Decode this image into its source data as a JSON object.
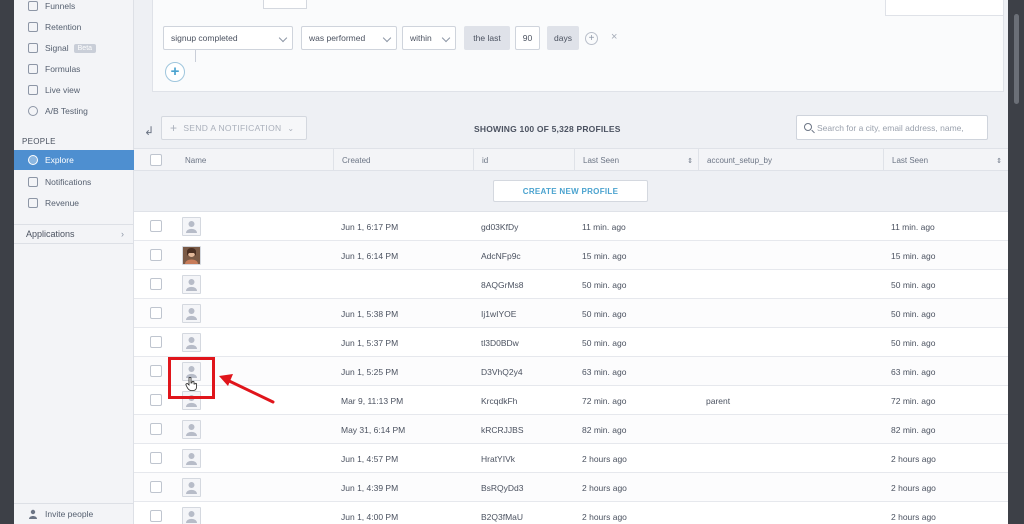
{
  "sidebar": {
    "items_top": [
      {
        "label": "Funnels",
        "icon": "funnel-icon"
      },
      {
        "label": "Retention",
        "icon": "retention-icon"
      },
      {
        "label": "Signal",
        "icon": "signal-icon",
        "badge": "Beta"
      },
      {
        "label": "Formulas",
        "icon": "formula-icon"
      },
      {
        "label": "Live view",
        "icon": "live-view-icon"
      },
      {
        "label": "A/B Testing",
        "icon": "ab-testing-icon"
      }
    ],
    "people_heading": "PEOPLE",
    "people_items": [
      {
        "label": "Explore",
        "icon": "explore-icon",
        "active": true
      },
      {
        "label": "Notifications",
        "icon": "notifications-icon"
      },
      {
        "label": "Revenue",
        "icon": "revenue-icon"
      }
    ],
    "applications_label": "Applications",
    "applications_chevron": "›",
    "invite_label": "Invite people"
  },
  "filter": {
    "event": "signup completed",
    "condition": "was performed",
    "timeframe": "within",
    "the_last": "the last",
    "number": "90",
    "unit": "days",
    "add_small": "+",
    "remove": "×",
    "add_big": "+"
  },
  "toolbar": {
    "send_notification": "SEND A NOTIFICATION",
    "showing": "SHOWING 100 OF 5,328 PROFILES",
    "search_placeholder": "Search for a city, email address, name,"
  },
  "table": {
    "columns": [
      "Name",
      "Created",
      "id",
      "Last Seen",
      "account_setup_by",
      "Last Seen"
    ],
    "create_profile": "CREATE NEW PROFILE",
    "rows": [
      {
        "created": "Jun 1, 6:17 PM",
        "id": "gd03KfDy",
        "last_seen": "11 min. ago",
        "setup_by": "",
        "last_seen2": "11 min. ago",
        "photo": false
      },
      {
        "created": "Jun 1, 6:14 PM",
        "id": "AdcNFp9c",
        "last_seen": "15 min. ago",
        "setup_by": "",
        "last_seen2": "15 min. ago",
        "photo": true
      },
      {
        "created": "",
        "id": "8AQGrMs8",
        "last_seen": "50 min. ago",
        "setup_by": "",
        "last_seen2": "50 min. ago",
        "photo": false
      },
      {
        "created": "Jun 1, 5:38 PM",
        "id": "Ij1wIYOE",
        "last_seen": "50 min. ago",
        "setup_by": "",
        "last_seen2": "50 min. ago",
        "photo": false
      },
      {
        "created": "Jun 1, 5:37 PM",
        "id": "tl3D0BDw",
        "last_seen": "50 min. ago",
        "setup_by": "",
        "last_seen2": "50 min. ago",
        "photo": false
      },
      {
        "created": "Jun 1, 5:25 PM",
        "id": "D3VhQ2y4",
        "last_seen": "63 min. ago",
        "setup_by": "",
        "last_seen2": "63 min. ago",
        "photo": false
      },
      {
        "created": "Mar 9, 11:13 PM",
        "id": "KrcqdkFh",
        "last_seen": "72 min. ago",
        "setup_by": "parent",
        "last_seen2": "72 min. ago",
        "photo": false
      },
      {
        "created": "May 31, 6:14 PM",
        "id": "kRCRJJBS",
        "last_seen": "82 min. ago",
        "setup_by": "",
        "last_seen2": "82 min. ago",
        "photo": false
      },
      {
        "created": "Jun 1, 4:57 PM",
        "id": "HratYIVk",
        "last_seen": "2 hours ago",
        "setup_by": "",
        "last_seen2": "2 hours ago",
        "photo": false
      },
      {
        "created": "Jun 1, 4:39 PM",
        "id": "BsRQyDd3",
        "last_seen": "2 hours ago",
        "setup_by": "",
        "last_seen2": "2 hours ago",
        "photo": false
      },
      {
        "created": "Jun 1, 4:00 PM",
        "id": "B2Q3fMaU",
        "last_seen": "2 hours ago",
        "setup_by": "",
        "last_seen2": "2 hours ago",
        "photo": false
      }
    ]
  },
  "colors": {
    "accent": "#4e8fd0",
    "link": "#4ba3cf",
    "highlight": "#e0151b"
  }
}
